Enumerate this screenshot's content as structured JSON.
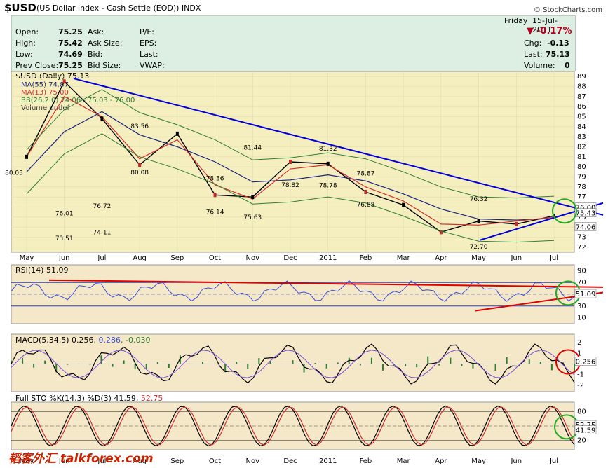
{
  "header": {
    "symbol": "$USD",
    "description": "(US Dollar Index - Cash Settle (EOD))",
    "exchange": "INDX",
    "brand": "© StockCharts.com"
  },
  "quote": {
    "day": "Friday",
    "date": "15-Jul-2011",
    "open_label": "Open:",
    "open": "75.25",
    "high_label": "High:",
    "high": "75.42",
    "low_label": "Low:",
    "low": "74.69",
    "prev_close_label": "Prev Close:",
    "prev_close": "75.25",
    "ask_label": "Ask:",
    "ask_size_label": "Ask Size:",
    "bid_label": "Bid:",
    "bid_size_label": "Bid Size:",
    "pe_label": "P/E:",
    "eps_label": "EPS:",
    "last_label": "Last:",
    "vwap_label": "VWAP:",
    "pct_change": "-0.17%",
    "chg_label": "Chg:",
    "chg": "-0.13",
    "last_label2": "Last:",
    "last": "75.13",
    "volume_label": "Volume:",
    "volume": "0"
  },
  "legend": {
    "price": "$USD (Daily) 75.13",
    "ma55": "MA(55) 74.87",
    "ma13": "MA(13) 75.00",
    "bb": "BB(26,2.0) 74.06 - 75.03 - 76.00",
    "volume": "Volume undef"
  },
  "panels": {
    "rsi": "RSI(14) 51.09",
    "macd_a": "MACD(5,34,5) 0.256,",
    "macd_b": "0.286",
    "macd_c": ", -0.030",
    "sto_a": "Full STO %K(14,3) %D(3) 41.59,",
    "sto_b": "52.75"
  },
  "watermark": "韬客外汇 talkforex.com",
  "colors": {
    "panel_bg": "#f5e8c9",
    "price_bg": "#f5efc0",
    "price": "#000000",
    "ma55": "#1a237e",
    "ma13": "#d32f2f",
    "bb": "#2e7d32",
    "trend": "#0000dd",
    "rsi": "#3b4fd8",
    "red_line": "#e00000",
    "circle_green": "#22aa22",
    "circle_red": "#dd0000",
    "up_candle": "#000000",
    "down_candle": "#c62828"
  },
  "chart_data": {
    "type": "line",
    "title": "$USD (Daily) 75.13",
    "x_ticks": [
      "May",
      "Jun",
      "Jul",
      "Aug",
      "Sep",
      "Oct",
      "Nov",
      "Dec",
      "2011",
      "Feb",
      "Mar",
      "Apr",
      "May",
      "Jun",
      "Jul"
    ],
    "y_ticks": [
      72,
      73,
      74,
      75,
      76,
      77,
      78,
      79,
      80,
      81,
      82,
      83,
      84,
      85,
      86,
      87,
      88,
      89
    ],
    "ylim": [
      71.5,
      89.5
    ],
    "x": [
      "May",
      "Jun",
      "Jul",
      "Aug",
      "Sep",
      "Oct",
      "Nov",
      "Dec",
      "2011",
      "Feb",
      "Mar",
      "Apr",
      "May",
      "Jun",
      "Jul"
    ],
    "series": [
      {
        "name": "$USD (Daily)",
        "values": [
          81.0,
          88.5,
          84.8,
          80.2,
          83.3,
          77.2,
          77.0,
          80.5,
          80.3,
          77.5,
          76.2,
          73.5,
          74.6,
          74.3,
          75.13
        ]
      },
      {
        "name": "MA(55)",
        "values": [
          79.5,
          83.5,
          85.5,
          83.2,
          82.0,
          80.5,
          78.5,
          78.7,
          79.2,
          78.6,
          77.3,
          75.8,
          74.8,
          74.7,
          74.87
        ]
      },
      {
        "name": "MA(13)",
        "values": [
          81.0,
          87.0,
          85.0,
          80.8,
          82.7,
          78.2,
          76.8,
          79.8,
          80.2,
          78.0,
          76.6,
          74.3,
          74.2,
          74.6,
          75.0
        ]
      }
    ],
    "annotations": [
      {
        "text": "80.03",
        "x": "May",
        "y": 80.03
      },
      {
        "text": "83.56",
        "x": "Aug",
        "y": 83.56
      },
      {
        "text": "80.08",
        "x": "Aug",
        "y": 80.08
      },
      {
        "text": "78.36",
        "x": "Oct",
        "y": 78.36
      },
      {
        "text": "76.14",
        "x": "Oct",
        "y": 76.14
      },
      {
        "text": "75.63",
        "x": "Nov",
        "y": 75.63
      },
      {
        "text": "81.44",
        "x": "Nov",
        "y": 81.44
      },
      {
        "text": "78.82",
        "x": "Dec",
        "y": 78.82
      },
      {
        "text": "81.32",
        "x": "2011",
        "y": 81.32
      },
      {
        "text": "78.78",
        "x": "2011",
        "y": 78.78
      },
      {
        "text": "78.87",
        "x": "Feb",
        "y": 78.87
      },
      {
        "text": "76.88",
        "x": "Feb",
        "y": 76.88
      },
      {
        "text": "72.70",
        "x": "May",
        "y": 72.7
      },
      {
        "text": "76.32",
        "x": "May",
        "y": 76.32
      },
      {
        "text": "73.51",
        "x": "Jun",
        "y": 73.51
      },
      {
        "text": "76.01",
        "x": "Jun",
        "y": 76.01
      },
      {
        "text": "74.11",
        "x": "Jul",
        "y": 74.11
      },
      {
        "text": "76.72",
        "x": "Jul",
        "y": 76.72
      }
    ],
    "right_labels": [
      "76.00",
      "75.43",
      "74.06"
    ],
    "rsi": {
      "label": "RSI(14) 51.09",
      "y_ticks": [
        90,
        70,
        50,
        30,
        10
      ],
      "ylim": [
        0,
        100
      ],
      "right_label": "51.09"
    },
    "macd": {
      "label": "MACD(5,34,5) 0.256, 0.286, -0.030",
      "y_ticks": [
        2,
        1,
        0,
        -1,
        -2
      ],
      "ylim": [
        -2.6,
        2.8
      ],
      "right_label": "0.256"
    },
    "sto": {
      "label": "Full STO %K(14,3) %D(3) 41.59, 52.75",
      "y_ticks": [
        80,
        50,
        20
      ],
      "ylim": [
        0,
        100
      ],
      "right_labels": [
        "52.75",
        "41.59"
      ]
    }
  }
}
